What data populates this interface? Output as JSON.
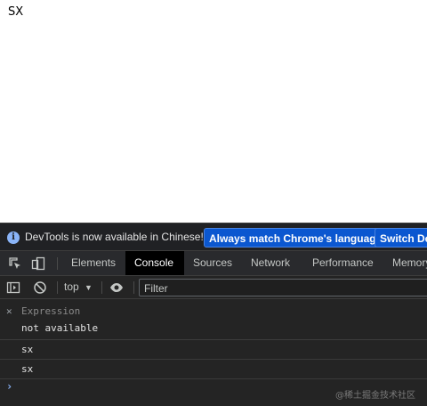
{
  "page": {
    "text": "SX"
  },
  "infobar": {
    "message": "DevTools is now available in Chinese!",
    "match_button": "Always match Chrome's language",
    "switch_button": "Switch DevTools to Chinese"
  },
  "tabs": [
    {
      "label": "Elements",
      "active": false
    },
    {
      "label": "Console",
      "active": true
    },
    {
      "label": "Sources",
      "active": false
    },
    {
      "label": "Network",
      "active": false
    },
    {
      "label": "Performance",
      "active": false
    },
    {
      "label": "Memory",
      "active": false
    }
  ],
  "toolbar": {
    "context": "top",
    "filter_placeholder": "Filter"
  },
  "console": {
    "expression_label": "Expression",
    "expression_value": "not available",
    "logs": [
      "sx",
      "sx"
    ]
  },
  "watermark": "@稀土掘金技术社区",
  "colors": {
    "accent_button": "#0b57d0",
    "panel_bg": "#242424",
    "info_icon": "#8ab4f8"
  }
}
